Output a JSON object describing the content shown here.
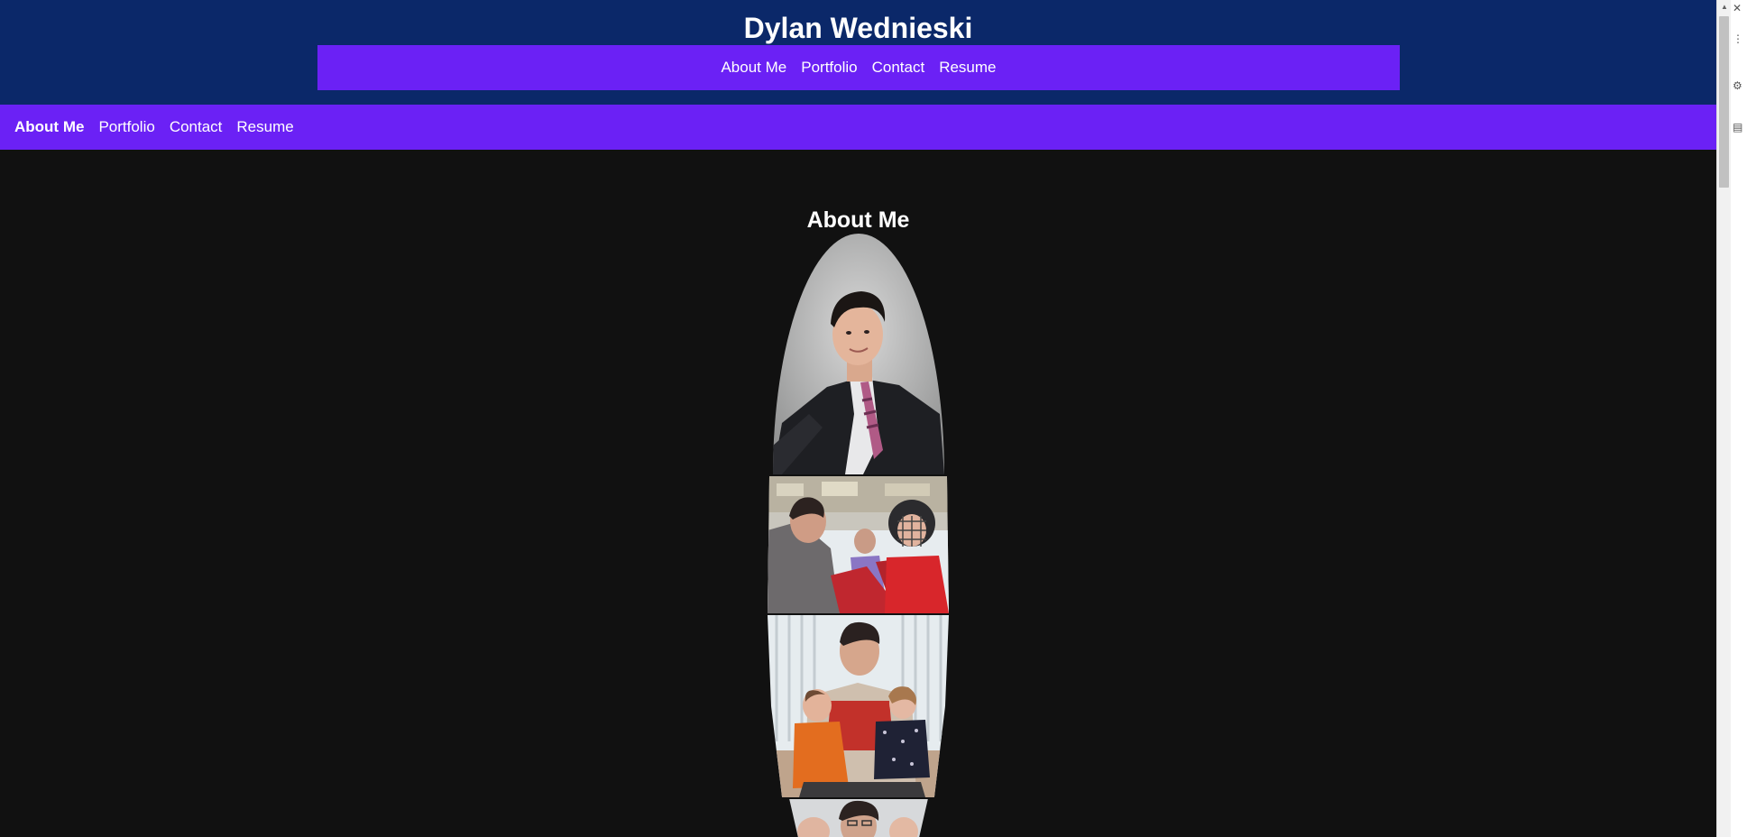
{
  "header": {
    "title": "Dylan Wednieski",
    "nav": [
      "About Me",
      "Portfolio",
      "Contact",
      "Resume"
    ]
  },
  "subnav": {
    "items": [
      "About Me",
      "Portfolio",
      "Contact",
      "Resume"
    ],
    "active": "About Me"
  },
  "about": {
    "heading": "About Me",
    "photos": [
      "portrait-photo",
      "hockey-rink-photo",
      "family-photo",
      "partial-photo"
    ]
  },
  "colors": {
    "header_bg": "#0b2869",
    "nav_bg": "#6b21f5",
    "page_bg": "#111111",
    "text": "#ffffff"
  }
}
